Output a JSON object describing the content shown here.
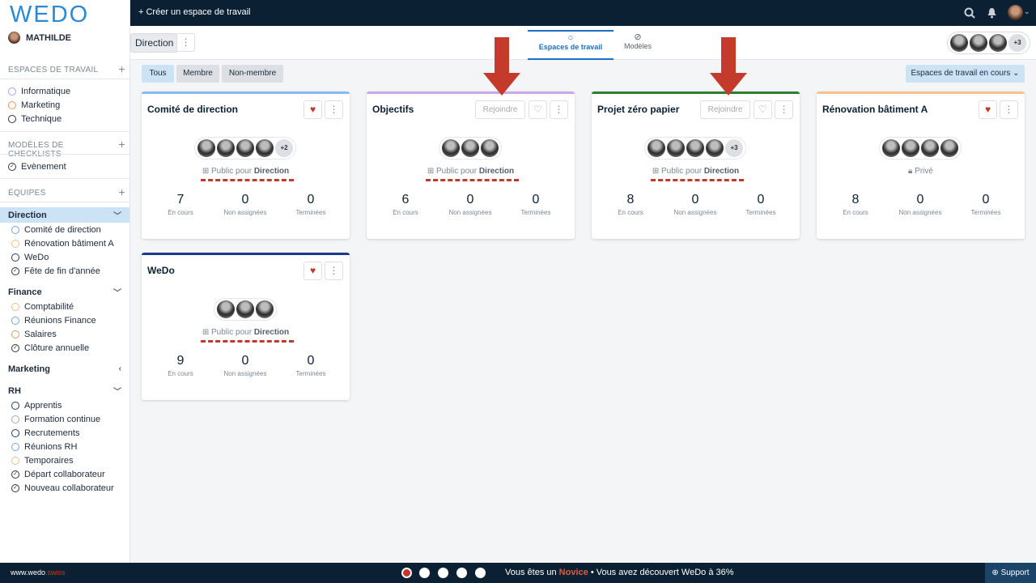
{
  "app": {
    "logo": "WEDO",
    "user_name": "MATHILDE"
  },
  "topbar": {
    "create_label": "+ Créer un espace de travail"
  },
  "sidebar": {
    "workspaces_header": "ESPACES DE TRAVAIL",
    "workspaces": [
      {
        "label": "Informatique",
        "color": "#b4a0e0"
      },
      {
        "label": "Marketing",
        "color": "#e8975a"
      },
      {
        "label": "Technique",
        "color": "#333333"
      }
    ],
    "templates_header": "MODÈLES DE CHECKLISTS",
    "templates": [
      {
        "label": "Evènement"
      }
    ],
    "teams_header": "ÉQUIPES",
    "teams": [
      {
        "name": "Direction",
        "items": [
          {
            "label": "Comité de direction",
            "color": "#6aa8e8"
          },
          {
            "label": "Rénovation bâtiment A",
            "color": "#f0c080"
          },
          {
            "label": "WeDo",
            "color": "#1b3a6b"
          },
          {
            "label": "Fête de fin d'année",
            "check": true
          }
        ]
      },
      {
        "name": "Finance",
        "items": [
          {
            "label": "Comptabilité",
            "color": "#f0c080"
          },
          {
            "label": "Réunions Finance",
            "color": "#6aa8e8"
          },
          {
            "label": "Salaires",
            "color": "#e8975a"
          },
          {
            "label": "Clôture annuelle",
            "check": true
          }
        ]
      },
      {
        "name": "Marketing",
        "items": []
      },
      {
        "name": "RH",
        "items": [
          {
            "label": "Apprentis",
            "color": "#1b3a6b"
          },
          {
            "label": "Formation continue",
            "color": "#aaaaaa"
          },
          {
            "label": "Recrutements",
            "color": "#1b3a6b"
          },
          {
            "label": "Réunions RH",
            "color": "#6aa8e8"
          },
          {
            "label": "Temporaires",
            "color": "#f0c080"
          },
          {
            "label": "Départ collaborateur",
            "check": true
          },
          {
            "label": "Nouveau collaborateur",
            "check": true
          }
        ]
      }
    ]
  },
  "subheader": {
    "team_label": "Direction",
    "tab_workspaces": "Espaces de travail",
    "tab_templates": "Modèles",
    "members_more": "+3"
  },
  "filters": {
    "all": "Tous",
    "member": "Membre",
    "non_member": "Non-membre",
    "status_dropdown": "Espaces de travail en cours"
  },
  "cards": [
    {
      "title": "Comité de direction",
      "color": "#8ab8f0",
      "fav": true,
      "join": false,
      "more": "+2",
      "avatars": 4,
      "visibility_prefix": "Public pour",
      "visibility_team": "Direction",
      "stats": [
        "7",
        "0",
        "0"
      ]
    },
    {
      "title": "Objectifs",
      "color": "#c9a8e8",
      "fav": false,
      "join": true,
      "more": "",
      "avatars": 3,
      "visibility_prefix": "Public pour",
      "visibility_team": "Direction",
      "stats": [
        "6",
        "0",
        "0"
      ]
    },
    {
      "title": "Projet zéro papier",
      "color": "#2e7d32",
      "fav": false,
      "join": true,
      "more": "+3",
      "avatars": 4,
      "visibility_prefix": "Public pour",
      "visibility_team": "Direction",
      "stats": [
        "8",
        "0",
        "0"
      ]
    },
    {
      "title": "Rénovation bâtiment A",
      "color": "#f5c48a",
      "fav": true,
      "join": false,
      "more": "",
      "avatars": 4,
      "visibility_prefix": "",
      "visibility_team": "Privé",
      "stats": [
        "8",
        "0",
        "0"
      ]
    },
    {
      "title": "WeDo",
      "color": "#1b3a8a",
      "fav": true,
      "join": false,
      "more": "",
      "avatars": 3,
      "visibility_prefix": "Public pour",
      "visibility_team": "Direction",
      "stats": [
        "9",
        "0",
        "0"
      ]
    }
  ],
  "labels": {
    "join": "Rejoindre",
    "in_progress": "En cours",
    "unassigned": "Non assignées",
    "done": "Terminées"
  },
  "footer": {
    "brand": "www.wedo",
    "brand_suffix": ".swiss",
    "progress_prefix": "Vous êtes un",
    "level": "Novice",
    "progress_suffix": "• Vous avez découvert WeDo à 36%",
    "support": "Support"
  }
}
